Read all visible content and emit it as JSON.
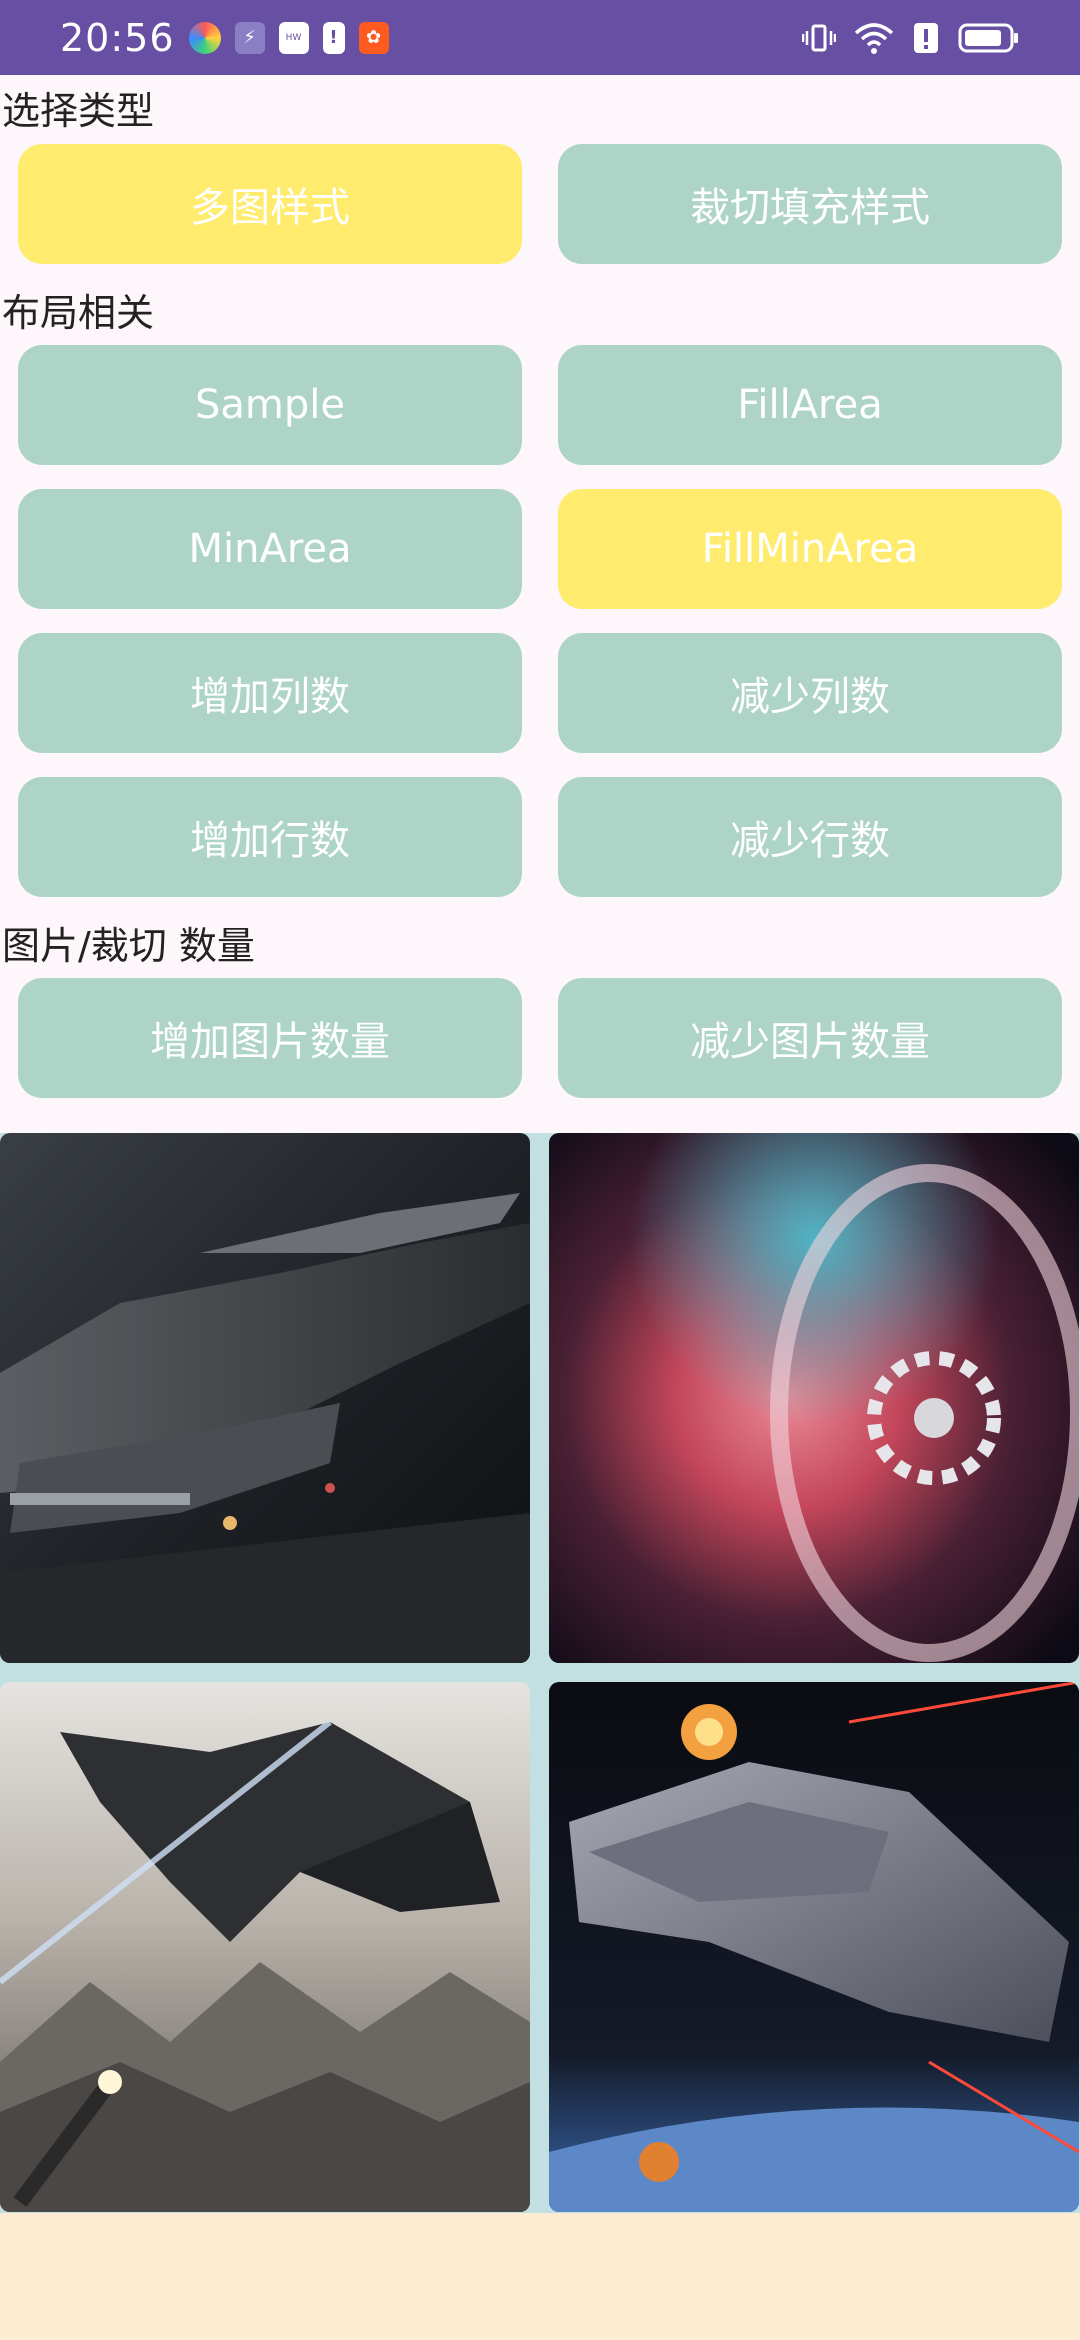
{
  "status_bar": {
    "time": "20:56"
  },
  "sections": {
    "select_type": "选择类型",
    "layout": "布局相关",
    "image_count": "图片/裁切 数量"
  },
  "buttons": {
    "multi_image_style": "多图样式",
    "crop_fill_style": "裁切填充样式",
    "sample": "Sample",
    "fill_area": "FillArea",
    "min_area": "MinArea",
    "fill_min_area": "FillMinArea",
    "add_columns": "增加列数",
    "reduce_columns": "减少列数",
    "add_rows": "增加行数",
    "reduce_rows": "减少行数",
    "add_images": "增加图片数量",
    "reduce_images": "减少图片数量"
  },
  "colors": {
    "status_bar": "#6750a4",
    "button_default": "#aed4c7",
    "button_active": "#ffec6e",
    "grid_background": "#c2e0e2",
    "bottom_background": "#fdebd2"
  },
  "images": [
    {
      "name": "spaceship-hangar-image"
    },
    {
      "name": "wormhole-station-image"
    },
    {
      "name": "fighter-over-mountains-image"
    },
    {
      "name": "battleship-in-orbit-image"
    }
  ]
}
